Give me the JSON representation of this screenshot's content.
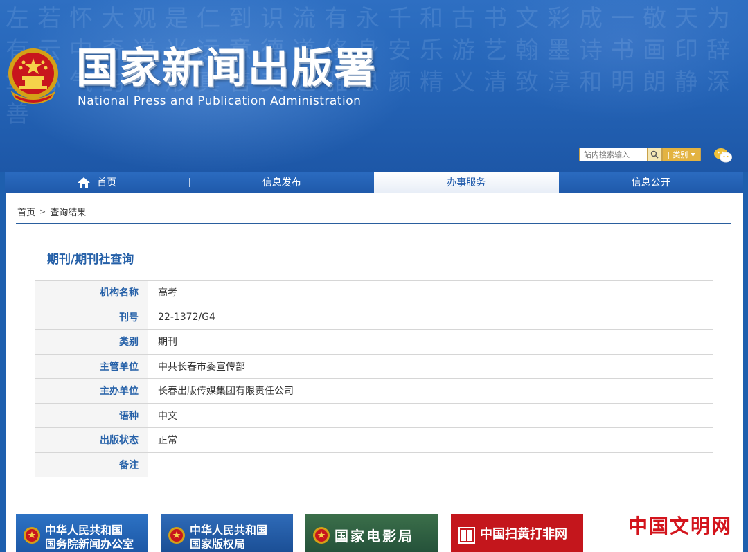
{
  "header": {
    "title": "国家新闻出版署",
    "subtitle": "National  Press and Publication Administration",
    "background_glyphs": "左若怀大观是仁到识流有永千和古书文彩成一敬天为有云中奇道光远意德道修身安乐游艺翰墨诗书画印辞章心气韵神形真善美之雅思颜精义清致淳和明朗静深善",
    "search": {
      "placeholder": "站内搜索输入",
      "category_label": "类别"
    }
  },
  "nav": {
    "items": [
      {
        "label": "首页"
      },
      {
        "label": "信息发布"
      },
      {
        "label": "办事服务"
      },
      {
        "label": "信息公开"
      }
    ],
    "active_index": 2
  },
  "breadcrumb": {
    "home": "首页",
    "separator": ">",
    "current": "查询结果"
  },
  "section_title": "期刊/期刊社查询",
  "record": {
    "rows": [
      {
        "label": "机构名称",
        "value": "高考"
      },
      {
        "label": "刊号",
        "value": "22-1372/G4"
      },
      {
        "label": "类别",
        "value": "期刊"
      },
      {
        "label": "主管单位",
        "value": "中共长春市委宣传部"
      },
      {
        "label": "主办单位",
        "value": "长春出版传媒集团有限责任公司"
      },
      {
        "label": "语种",
        "value": "中文"
      },
      {
        "label": "出版状态",
        "value": "正常"
      },
      {
        "label": "备注",
        "value": ""
      }
    ]
  },
  "footer_links": {
    "scio": "中华人民共和国\n国务院新闻办公室",
    "ncac": "中华人民共和国\n国家版权局",
    "film": "国家电影局",
    "shdf": "中国扫黄打非网",
    "civ": "中国文明网"
  },
  "colors": {
    "brand_blue": "#1f5aab",
    "label_blue": "#2560a8",
    "search_gold": "#e3b341"
  }
}
